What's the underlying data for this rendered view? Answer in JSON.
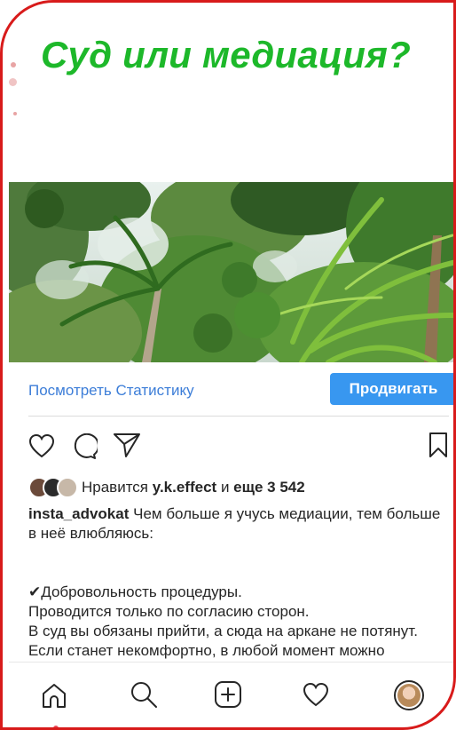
{
  "post": {
    "headline": "Суд или медиация?",
    "stats_link": "Посмотреть Статистику",
    "promote_button": "Продвигать"
  },
  "actions": {
    "icons": [
      "heart-icon",
      "comment-icon",
      "share-icon",
      "bookmark-icon"
    ]
  },
  "likes": {
    "prefix": "Нравится",
    "user": "y.k.effect",
    "joiner": "и",
    "count_text": "еще 3 542"
  },
  "caption": {
    "username": "insta_advokat",
    "line1": "Чем больше я учусь медиации, тем больше в неё влюбляюсь:",
    "check": "✔",
    "point": "Добровольность процедуры.",
    "line3": "Проводится только по согласию сторон.",
    "line4": "В суд вы обязаны прийти, а сюда на аркане не потянут.",
    "line5": "Если станет некомфортно, в любой момент можно"
  },
  "tabbar": {
    "items": [
      "home-icon",
      "search-icon",
      "add-post-icon",
      "activity-heart-icon",
      "profile-avatar"
    ]
  },
  "colors": {
    "headline": "#1db82a",
    "frame": "#d81b1b",
    "link": "#3d7ed8",
    "button": "#3897f0"
  }
}
